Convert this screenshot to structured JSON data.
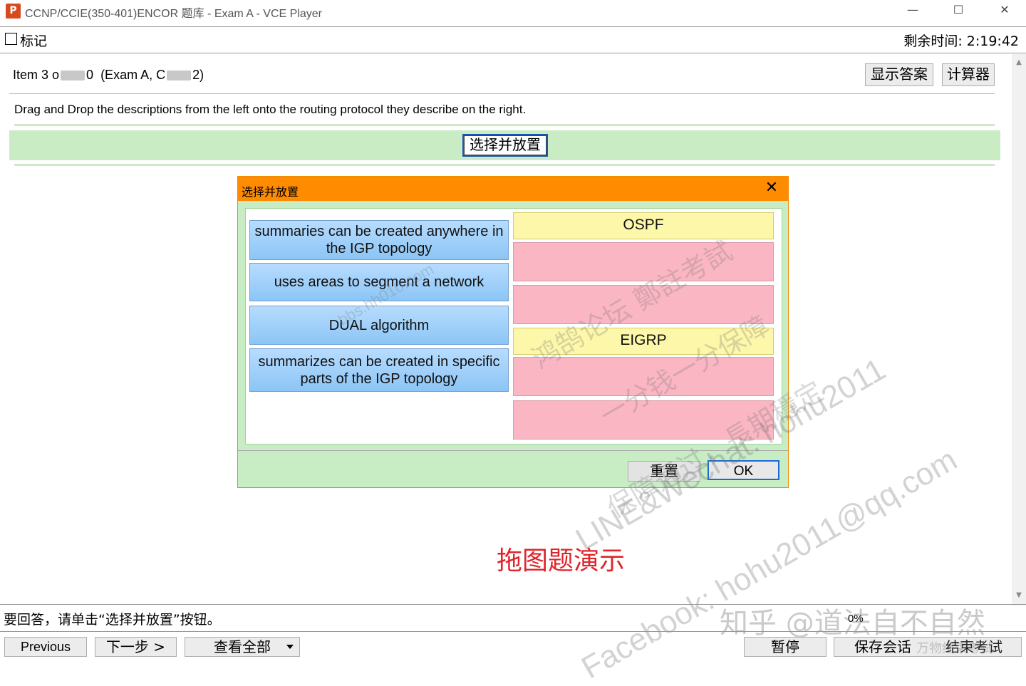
{
  "window": {
    "title": "CCNP/CCIE(350-401)ENCOR 题库 - Exam A - VCE Player",
    "app_icon": "P",
    "minimize": "—",
    "maximize": "☐",
    "close": "✕"
  },
  "header": {
    "mark_label": "标记",
    "time_remaining": "剩余时间: 2:19:42"
  },
  "item": {
    "prefix": "Item 3 o",
    "suffix": "0",
    "exam": "(Exam A, C",
    "exam_end": "2)"
  },
  "toolbar": {
    "show_answer": "显示答案",
    "calculator": "计算器"
  },
  "question": "Drag and Drop the descriptions from the left onto the routing protocol they describe on the right.",
  "select_and_place": "选择并放置",
  "dialog": {
    "title": "选择并放置",
    "close": "✕",
    "sources": [
      "summaries can be created anywhere in the IGP topology",
      "uses areas to segment a network",
      "DUAL algorithm",
      "summarizes can be created in specific parts of the IGP topology"
    ],
    "targets": {
      "ospf": "OSPF",
      "eigrp": "EIGRP"
    },
    "reset": "重置",
    "ok": "OK"
  },
  "demo_label": "拖图题演示",
  "status": {
    "hint": "要回答，请单击“选择并放置”按钮。",
    "progress": "0%"
  },
  "bottom": {
    "previous": "Previous",
    "next": "下一步 >",
    "review_all": "查看全部",
    "pause": "暂停",
    "save_session": "保存会话",
    "end_exam": "结束考试"
  },
  "watermarks": {
    "line1": "LINE&Wechat: hohu2011",
    "line2": "Facebook: hohu2011@qq.com",
    "line3": "保障通过，長期穩定",
    "line4": "一分钱一分保障",
    "line5": "鸿鹄论坛 鄭註考試",
    "line6": "bbs.hh010.com",
    "zhihu": "知乎 @道法自不自然",
    "zhihu2": "万物结束考试"
  },
  "colors": {
    "dialog_header": "#ff8c00",
    "band_green": "#c9ecc4",
    "source_blue": "#8cc5f5",
    "target_yellow": "#fdf7aa",
    "target_pink": "#fbb6c3",
    "demo_red": "#e0242a"
  }
}
